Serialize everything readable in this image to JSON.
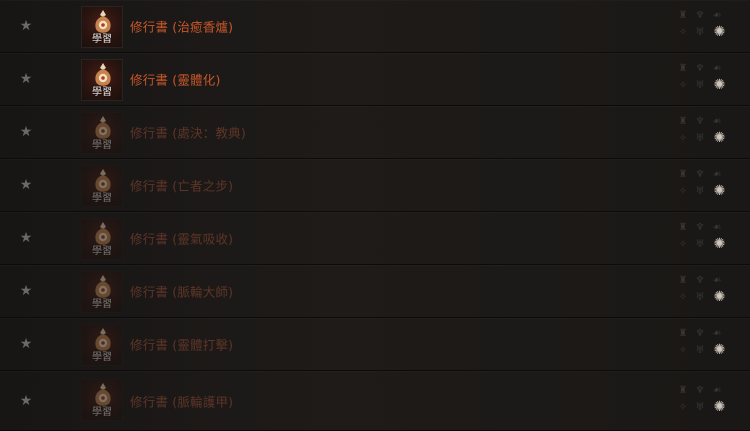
{
  "colors": {
    "active_name": "#c8572a",
    "dim_name": "#5e3527",
    "background": "#1b1918",
    "star": "#6d6863",
    "class_icon_faded": "#3a3532",
    "class_icon_highlight": "#cfc6bc"
  },
  "items": [
    {
      "tag": "學習",
      "name": "修行書 (治癒香爐)",
      "state": "active",
      "star_icon": "star-icon",
      "icon": "book-emblem-icon",
      "highlight_class_icon": "necromancer-icon"
    },
    {
      "tag": "學習",
      "name": "修行書 (靈體化)",
      "state": "active",
      "star_icon": "star-icon",
      "icon": "book-emblem-icon",
      "highlight_class_icon": "necromancer-icon"
    },
    {
      "tag": "學習",
      "name": "修行書 (處決：教典)",
      "state": "dim",
      "star_icon": "star-icon",
      "icon": "book-emblem-icon",
      "highlight_class_icon": "necromancer-icon"
    },
    {
      "tag": "學習",
      "name": "修行書 (亡者之步)",
      "state": "dim",
      "star_icon": "star-icon",
      "icon": "book-emblem-icon",
      "highlight_class_icon": "necromancer-icon"
    },
    {
      "tag": "學習",
      "name": "修行書 (靈氣吸收)",
      "state": "dim",
      "star_icon": "star-icon",
      "icon": "book-emblem-icon",
      "highlight_class_icon": "necromancer-icon"
    },
    {
      "tag": "學習",
      "name": "修行書 (脈輪大師)",
      "state": "dim",
      "star_icon": "star-icon",
      "icon": "book-emblem-icon",
      "highlight_class_icon": "necromancer-icon"
    },
    {
      "tag": "學習",
      "name": "修行書 (靈體打擊)",
      "state": "dim",
      "star_icon": "star-icon",
      "icon": "book-emblem-icon",
      "highlight_class_icon": "necromancer-icon"
    },
    {
      "tag": "學習",
      "name": "修行書 (脈輪護甲)",
      "state": "dim",
      "star_icon": "star-icon",
      "icon": "book-emblem-icon",
      "highlight_class_icon": "necromancer-icon"
    }
  ]
}
